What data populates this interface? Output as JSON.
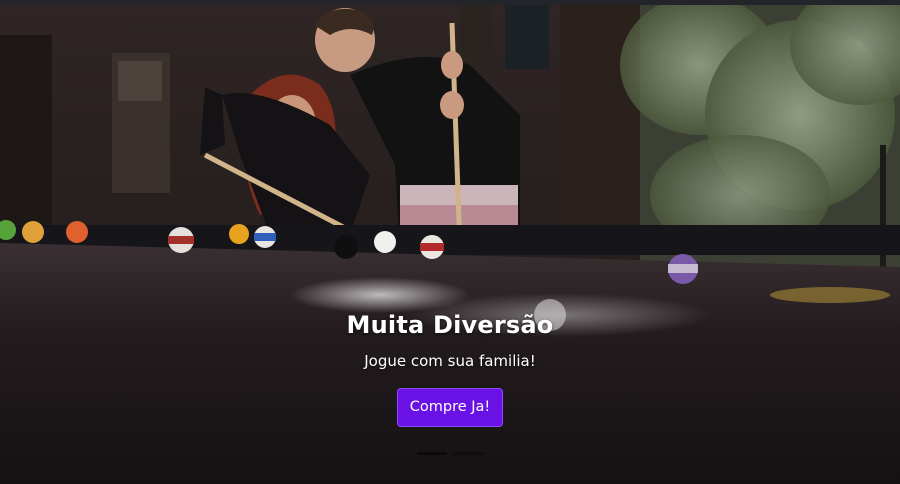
{
  "carousel": {
    "slides": [
      {
        "title": "Muita Diversão",
        "text": "Jogue com sua familia!",
        "button_label": "Compre Ja!"
      }
    ],
    "active_index": 0,
    "indicator_count": 2
  },
  "colors": {
    "button_bg": "#6a11e6",
    "button_border": "#8a4dff",
    "caption_text": "#ffffff",
    "felt": "#2b2224"
  },
  "image": {
    "subject": "couple-playing-pool-photo"
  }
}
